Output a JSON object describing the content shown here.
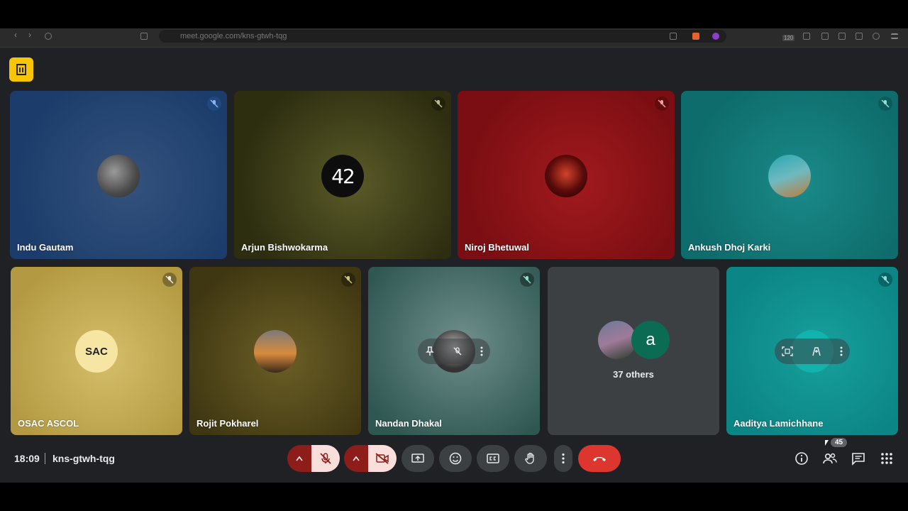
{
  "browser": {
    "url": "meet.google.com/kns-gtwh-tqg",
    "badge": "120"
  },
  "meeting": {
    "time": "18:09",
    "code": "kns-gtwh-tqg",
    "participant_count": "45"
  },
  "tiles": [
    {
      "name": "Indu Gautam",
      "color": "#1c3d6b",
      "muted": true
    },
    {
      "name": "Arjun Bishwokarma",
      "color": "#2d2e10",
      "muted": true
    },
    {
      "name": "Niroj Bhetuwal",
      "color": "#7a0e12",
      "muted": true
    },
    {
      "name": "Ankush Dhoj Karki",
      "color": "#0e6c6c",
      "muted": true
    },
    {
      "name": "OSAC ASCOL",
      "color": "#c2a54a",
      "muted": true
    },
    {
      "name": "Rojit Pokharel",
      "color": "#4e4418",
      "muted": true
    },
    {
      "name": "Nandan Dhakal",
      "color": "#3a6b65",
      "muted": true
    },
    {
      "name": "Aaditya Lamichhane",
      "color": "#0b8585",
      "muted": true
    }
  ],
  "others": {
    "text": "37 others",
    "initial": "a"
  },
  "avatars": {
    "arjun_text": "42",
    "osac_text": "SAC"
  }
}
